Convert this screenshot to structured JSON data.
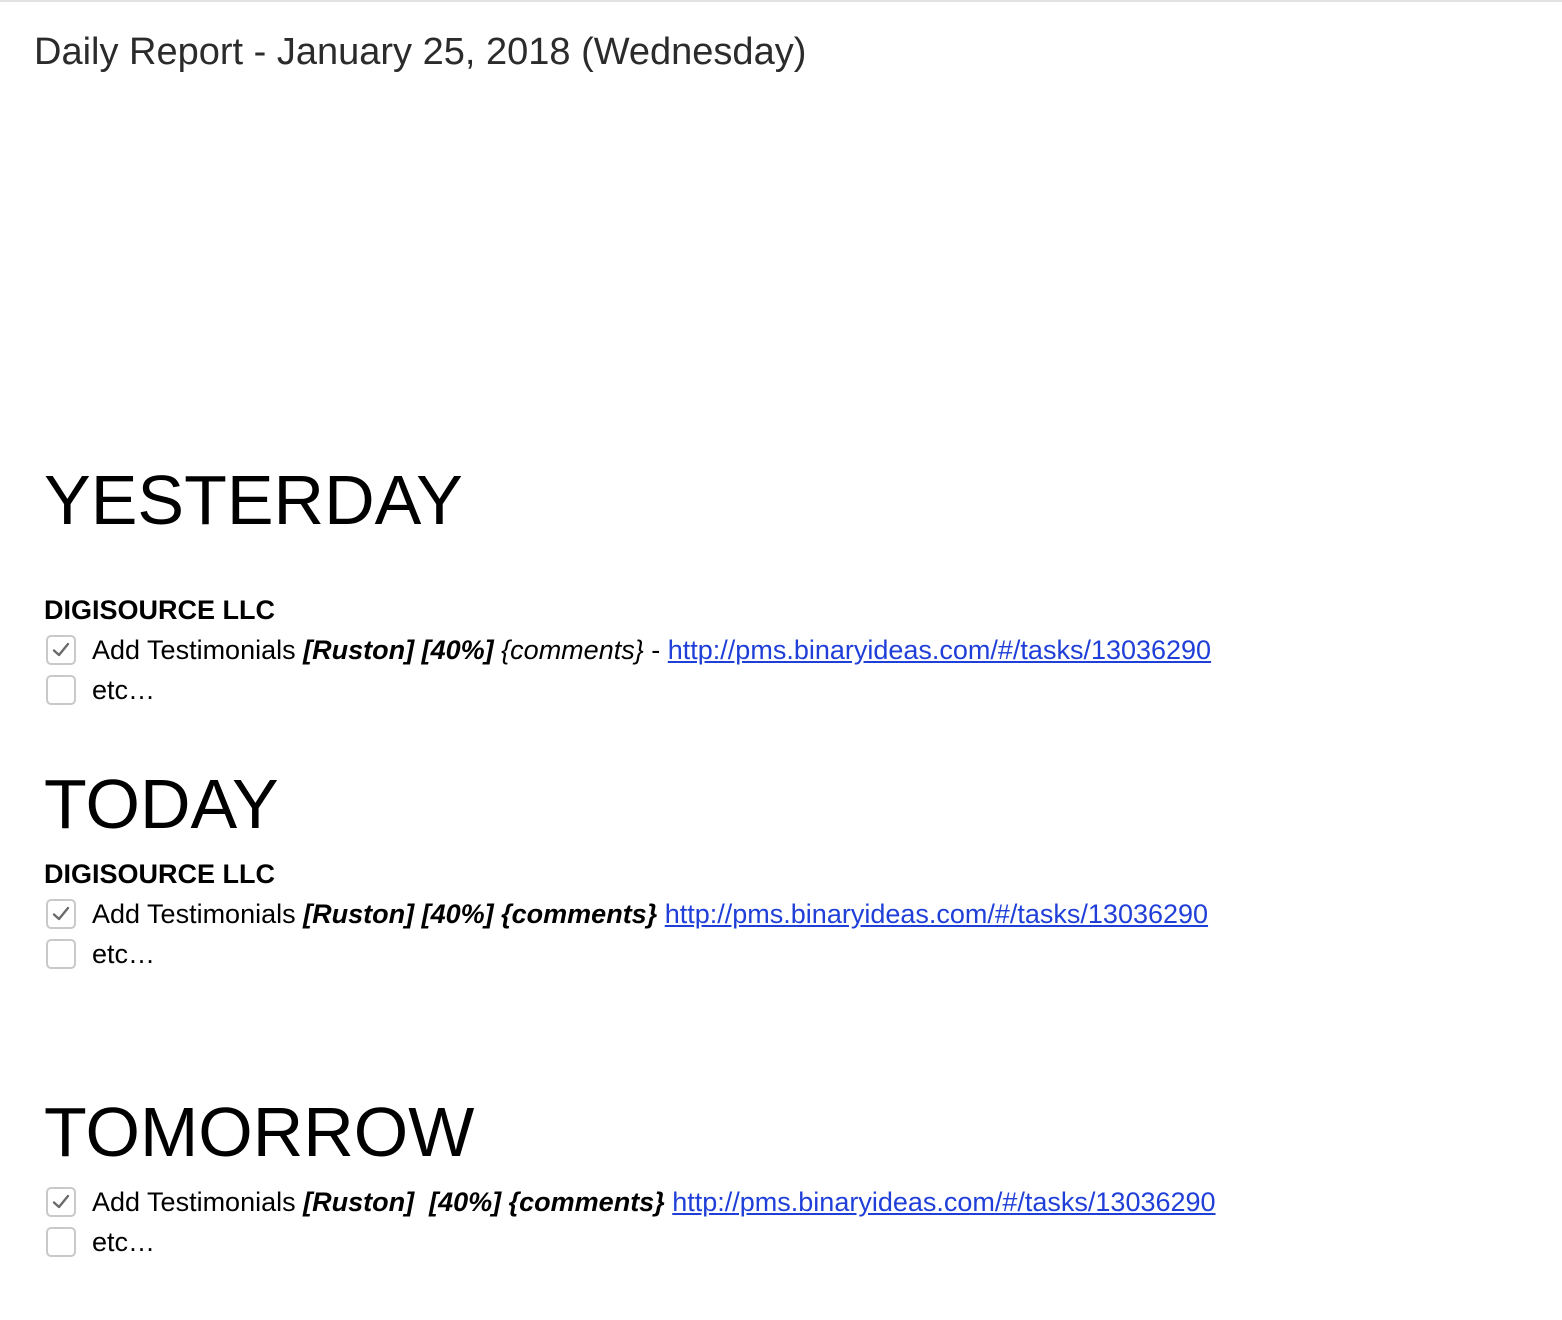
{
  "document": {
    "title": "Daily Report - January 25, 2018 (Wednesday)"
  },
  "sections": {
    "yesterday": {
      "heading": "YESTERDAY",
      "client": "DIGISOURCE LLC",
      "task": {
        "checked": true,
        "name": "Add Testimonials",
        "assignee": "[Ruston]",
        "percent": "[40%]",
        "comments": "{comments}",
        "separator": "-",
        "link": "http://pms.binaryideas.com/#/tasks/13036290"
      },
      "etc": {
        "checked": false,
        "label": "etc…"
      }
    },
    "today": {
      "heading": "TODAY",
      "client": "DIGISOURCE LLC",
      "task": {
        "checked": true,
        "name": "Add Testimonials",
        "assignee": "[Ruston]",
        "percent": "[40%]",
        "comments": "{comments}",
        "link": "http://pms.binaryideas.com/#/tasks/13036290"
      },
      "etc": {
        "checked": false,
        "label": "etc…"
      }
    },
    "tomorrow": {
      "heading": "TOMORROW",
      "task": {
        "checked": true,
        "name": "Add Testimonials",
        "assignee": "[Ruston]",
        "percent": "[40%]",
        "comments": "{comments}",
        "link": "http://pms.binaryideas.com/#/tasks/13036290"
      },
      "etc": {
        "checked": false,
        "label": "etc…"
      }
    }
  }
}
